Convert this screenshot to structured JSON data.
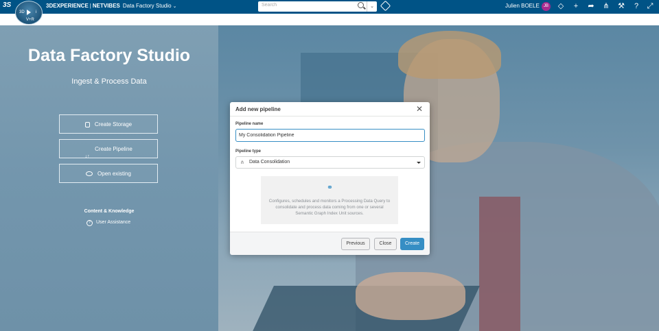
{
  "topbar": {
    "brand_bold": "3DEXPERIENCE",
    "brand_sep": "|",
    "brand_company": "NETVIBES",
    "app_name": "Data Factory Studio",
    "search_placeholder": "Search",
    "user_name": "Julien BOELE",
    "user_initials": "JB",
    "compass_labels": [
      "3D",
      "V+R",
      "i"
    ]
  },
  "left_panel": {
    "title": "Data Factory Studio",
    "subtitle": "Ingest & Process Data",
    "buttons": [
      {
        "label": "Create Storage",
        "icon": "database-icon"
      },
      {
        "label": "Create Pipeline",
        "icon": "pipeline-icon"
      },
      {
        "label": "Open existing",
        "icon": "eye-icon"
      }
    ],
    "content_title": "Content & Knowledge",
    "user_assistance": "User Assistance"
  },
  "modal": {
    "title": "Add new pipeline",
    "pipeline_name_label": "Pipeline name",
    "pipeline_name_value": "My Consolidation Pipeline",
    "pipeline_type_label": "Pipeline type",
    "pipeline_type_value": "Data Consolidation",
    "description": "Configures, schedules and monitors a Processing Data Query to consolidate and process data coming from one or several Semantic Graph Index Unit sources.",
    "buttons": {
      "previous": "Previous",
      "close": "Close",
      "create": "Create"
    }
  },
  "colors": {
    "topbar": "#005386",
    "accent": "#368ec4",
    "avatar": "#a62b8f"
  }
}
